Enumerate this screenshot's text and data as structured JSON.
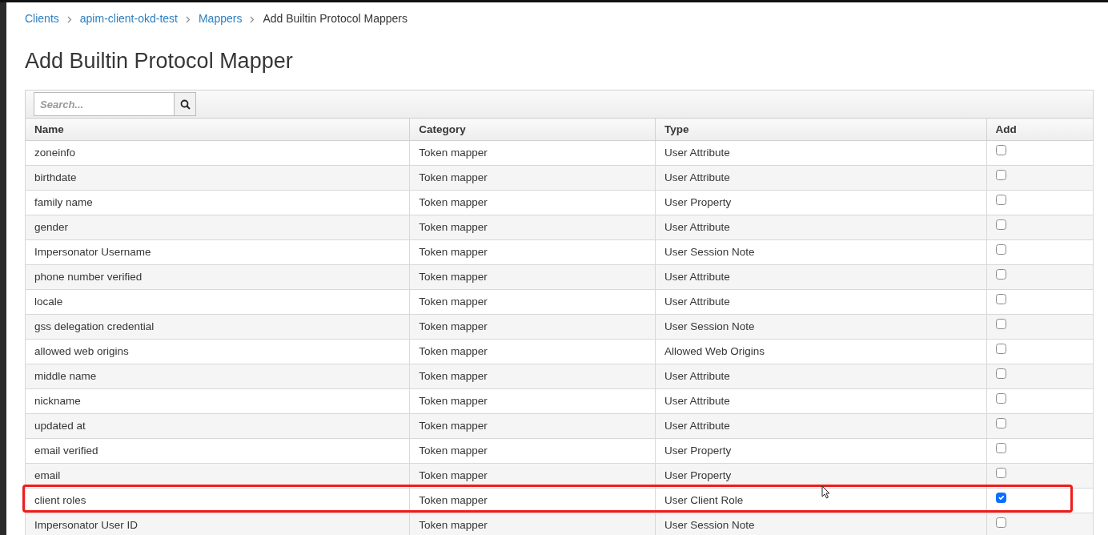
{
  "breadcrumb": [
    {
      "label": "Clients",
      "link": true
    },
    {
      "label": "apim-client-okd-test",
      "link": true
    },
    {
      "label": "Mappers",
      "link": true
    },
    {
      "label": "Add Builtin Protocol Mappers",
      "link": false
    }
  ],
  "title": "Add Builtin Protocol Mapper",
  "search": {
    "placeholder": "Search..."
  },
  "table": {
    "columns": [
      "Name",
      "Category",
      "Type",
      "Add"
    ],
    "rows": [
      {
        "name": "zoneinfo",
        "category": "Token mapper",
        "type": "User Attribute",
        "checked": false,
        "highlighted": false
      },
      {
        "name": "birthdate",
        "category": "Token mapper",
        "type": "User Attribute",
        "checked": false,
        "highlighted": false
      },
      {
        "name": "family name",
        "category": "Token mapper",
        "type": "User Property",
        "checked": false,
        "highlighted": false
      },
      {
        "name": "gender",
        "category": "Token mapper",
        "type": "User Attribute",
        "checked": false,
        "highlighted": false
      },
      {
        "name": "Impersonator Username",
        "category": "Token mapper",
        "type": "User Session Note",
        "checked": false,
        "highlighted": false
      },
      {
        "name": "phone number verified",
        "category": "Token mapper",
        "type": "User Attribute",
        "checked": false,
        "highlighted": false
      },
      {
        "name": "locale",
        "category": "Token mapper",
        "type": "User Attribute",
        "checked": false,
        "highlighted": false
      },
      {
        "name": "gss delegation credential",
        "category": "Token mapper",
        "type": "User Session Note",
        "checked": false,
        "highlighted": false
      },
      {
        "name": "allowed web origins",
        "category": "Token mapper",
        "type": "Allowed Web Origins",
        "checked": false,
        "highlighted": false
      },
      {
        "name": "middle name",
        "category": "Token mapper",
        "type": "User Attribute",
        "checked": false,
        "highlighted": false
      },
      {
        "name": "nickname",
        "category": "Token mapper",
        "type": "User Attribute",
        "checked": false,
        "highlighted": false
      },
      {
        "name": "updated at",
        "category": "Token mapper",
        "type": "User Attribute",
        "checked": false,
        "highlighted": false
      },
      {
        "name": "email verified",
        "category": "Token mapper",
        "type": "User Property",
        "checked": false,
        "highlighted": false
      },
      {
        "name": "email",
        "category": "Token mapper",
        "type": "User Property",
        "checked": false,
        "highlighted": false
      },
      {
        "name": "client roles",
        "category": "Token mapper",
        "type": "User Client Role",
        "checked": true,
        "highlighted": true
      },
      {
        "name": "Impersonator User ID",
        "category": "Token mapper",
        "type": "User Session Note",
        "checked": false,
        "highlighted": false
      }
    ]
  }
}
